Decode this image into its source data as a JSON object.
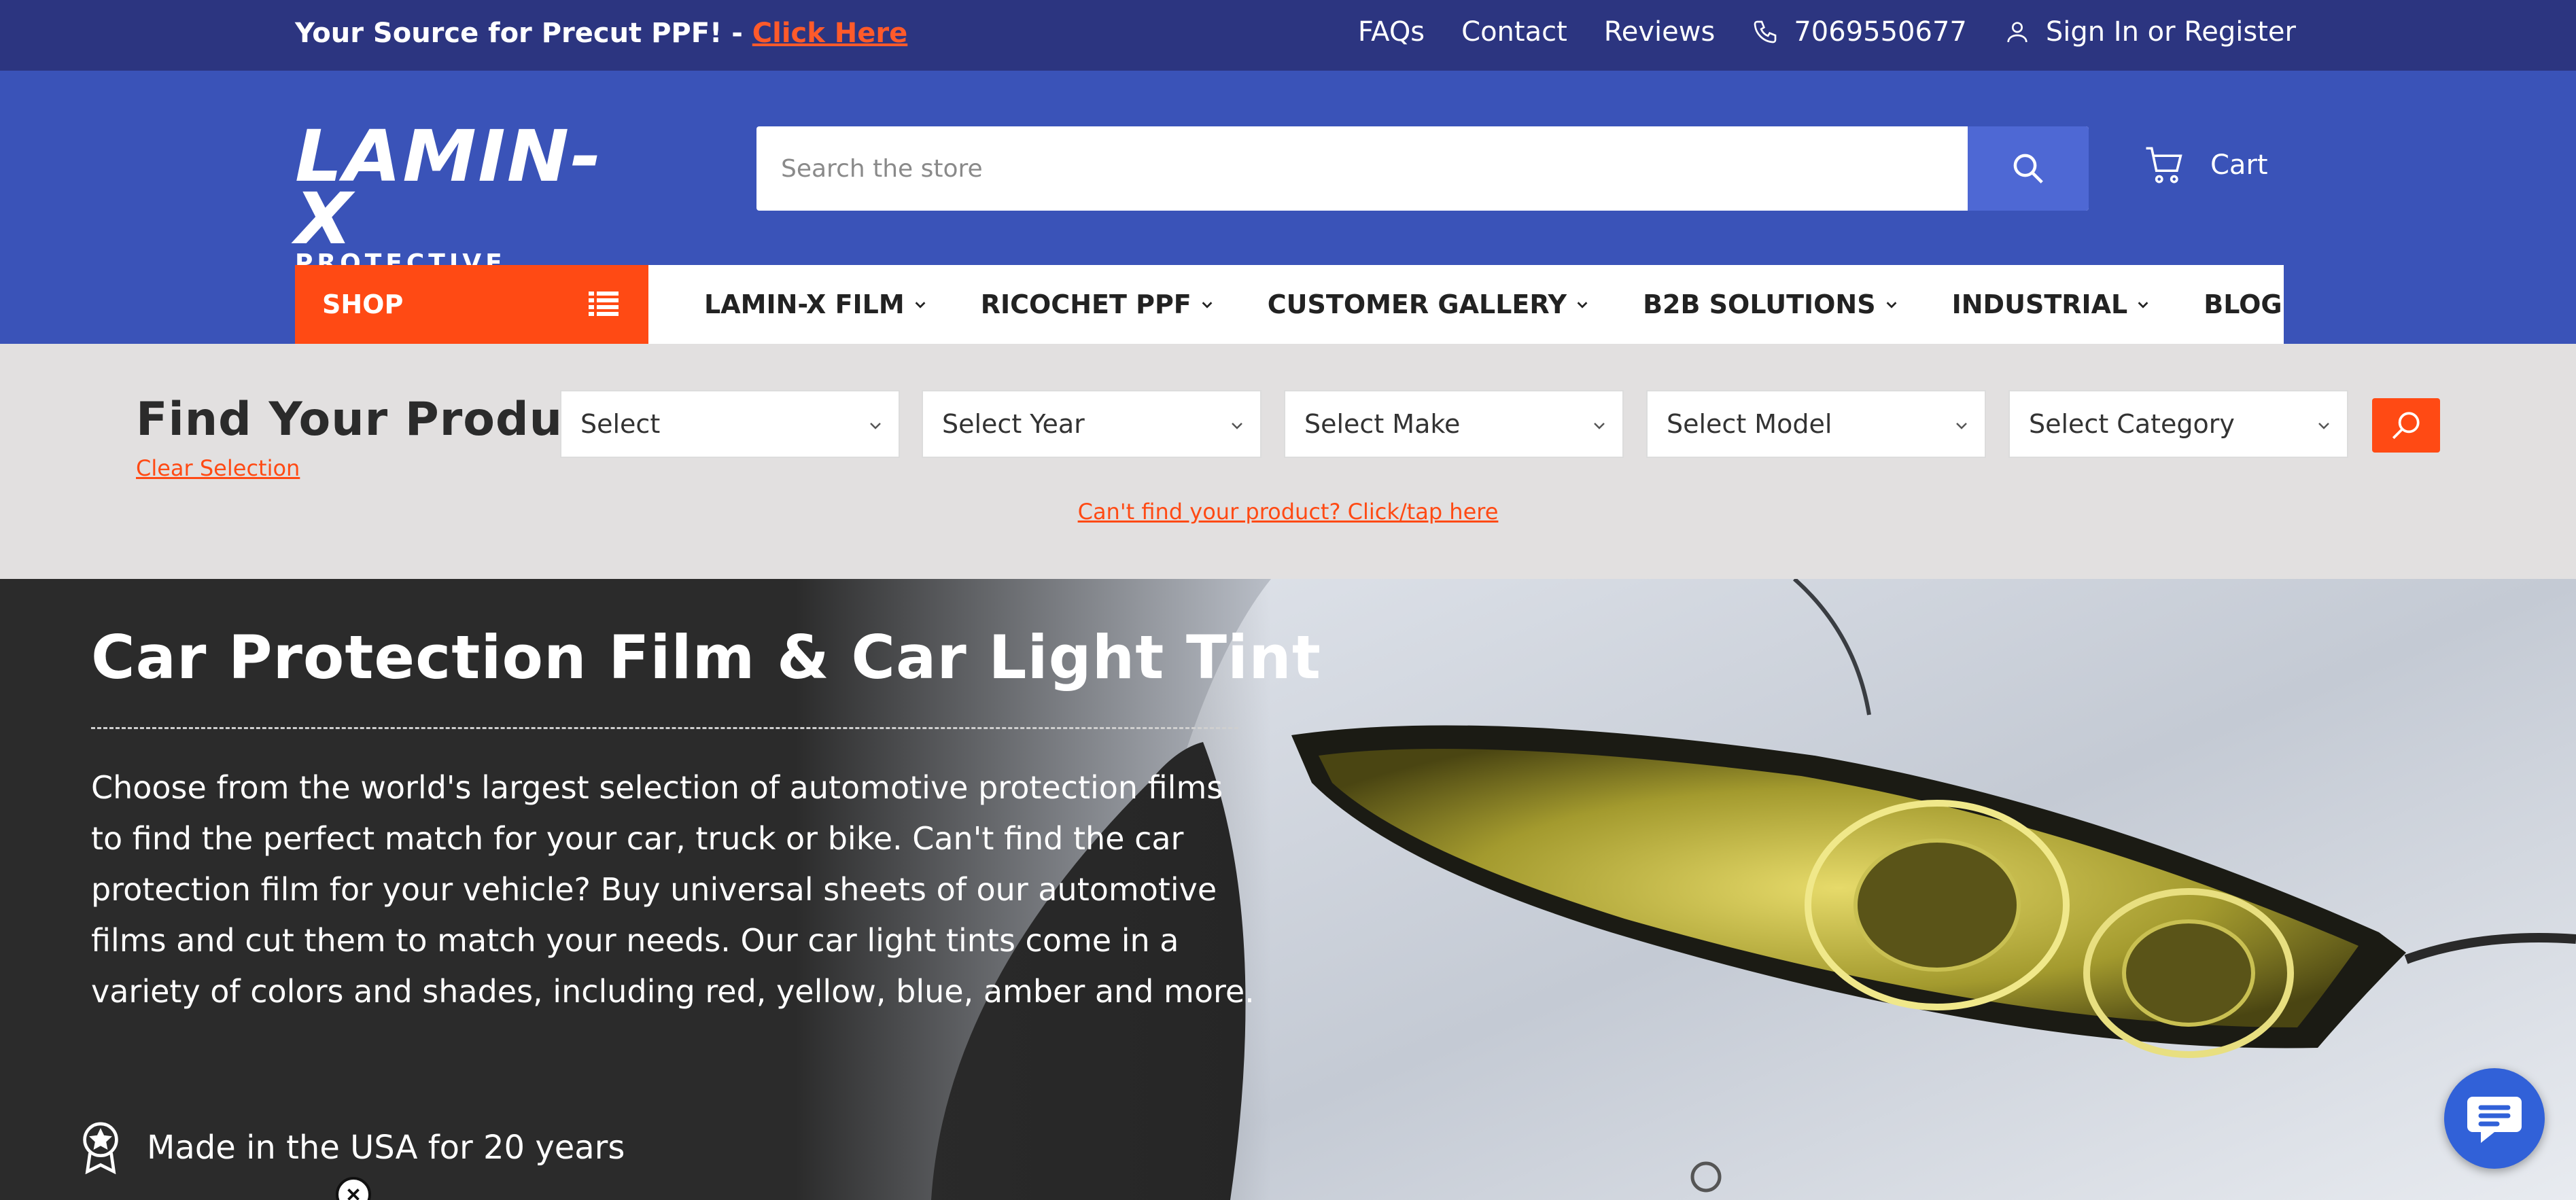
{
  "topbar": {
    "promo_text": "Your Source for Precut PPF! - ",
    "promo_link": "Click Here",
    "faqs": "FAQs",
    "contact": "Contact",
    "reviews": "Reviews",
    "phone": "7069550677",
    "account": "Sign In or Register"
  },
  "header": {
    "logo_word": "LAMIN-X",
    "logo_sub": "PROTECTIVE FILMS",
    "search_placeholder": "Search the store",
    "cart_label": "Cart"
  },
  "nav": {
    "shop_label": "SHOP",
    "items": [
      "LAMIN-X FILM",
      "RICOCHET PPF",
      "CUSTOMER GALLERY",
      "B2B SOLUTIONS",
      "INDUSTRIAL",
      "BLOG"
    ]
  },
  "finder": {
    "title": "Find Your Product",
    "clear": "Clear Selection",
    "selects": [
      "Select",
      "Select Year",
      "Select Make",
      "Select Model",
      "Select Category"
    ],
    "cant_find": "Can't find your product? Click/tap here"
  },
  "hero": {
    "title": "Car Protection Film & Car Light Tint",
    "body": "Choose from the world's largest selection of automotive protection films to find the perfect match for your car, truck or bike. Can't find the car protection film for your vehicle? Buy universal sheets of our automotive films and cut them to match your needs. Our car light tints come in a variety of colors and shades, including red, yellow, blue, amber and more.",
    "badge": "Made in the USA for 20 years"
  },
  "colors": {
    "topbar": "#2c3580",
    "header": "#3a53b8",
    "accent": "#ff4a14",
    "search_button": "#4e68d4",
    "chat": "#3161d8"
  }
}
